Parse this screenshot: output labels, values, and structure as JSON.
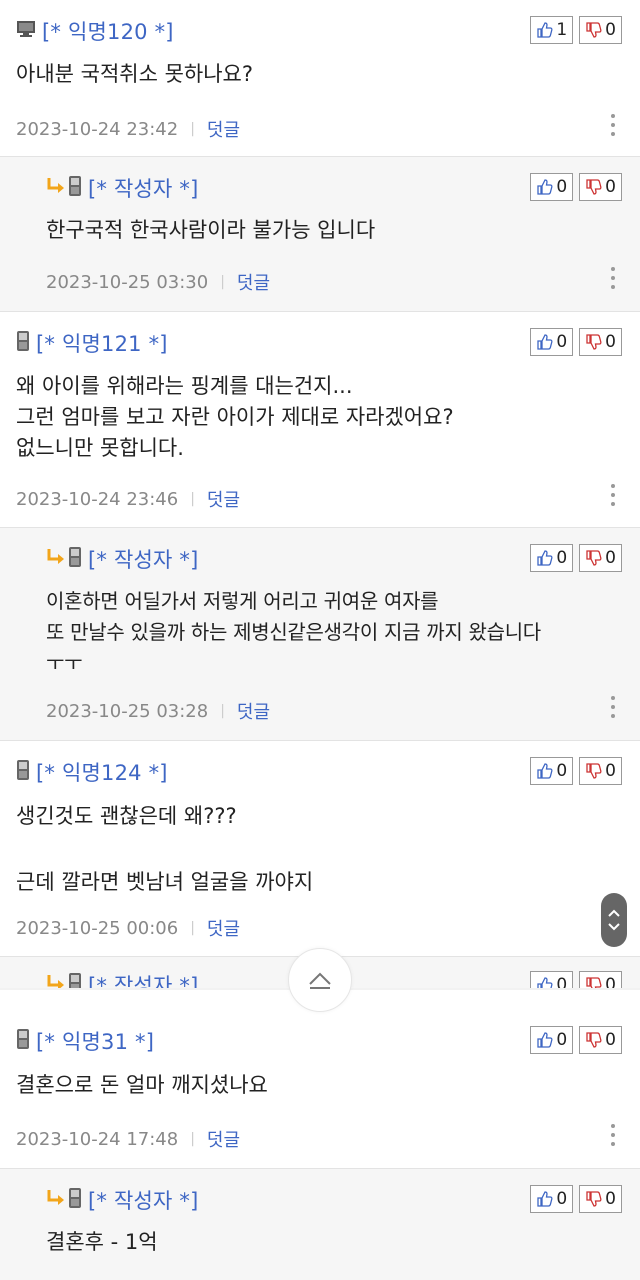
{
  "comments": [
    {
      "type": "comment",
      "device": "pc",
      "author": "[* 익명120 *]",
      "text": "아내분 국적취소 못하나요?",
      "date": "2023-10-24 23:42",
      "reply": "덧글",
      "up": "1",
      "down": "0"
    },
    {
      "type": "reply",
      "device": "mobile",
      "author": "[* 작성자 *]",
      "text": "한구국적 한국사람이라 불가능 입니다",
      "date": "2023-10-25 03:30",
      "reply": "덧글",
      "up": "0",
      "down": "0"
    },
    {
      "type": "comment",
      "device": "mobile",
      "author": "[* 익명121 *]",
      "text": "왜 아이를 위해라는 핑계를 대는건지...\n그런 엄마를 보고 자란 아이가 제대로 자라겠어요?\n없느니만 못합니다.",
      "date": "2023-10-24 23:46",
      "reply": "덧글",
      "up": "0",
      "down": "0"
    },
    {
      "type": "reply",
      "device": "mobile",
      "author": "[* 작성자 *]",
      "text": "이혼하면 어딜가서 저렇게 어리고 귀여운 여자를\n또 만날수 있을까 하는 제병신같은생각이 지금 까지 왔습니다\nㅜㅜ",
      "date": "2023-10-25 03:28",
      "reply": "덧글",
      "up": "0",
      "down": "0"
    },
    {
      "type": "comment",
      "device": "mobile",
      "author": "[* 익명124 *]",
      "text": "생긴것도 괜찮은데 왜???\n\n근데 깔라면 벳남녀 얼굴을 까야지",
      "date": "2023-10-25 00:06",
      "reply": "덧글",
      "up": "0",
      "down": "0"
    },
    {
      "type": "reply",
      "device": "mobile",
      "author": "[* 작성자 *]",
      "text": "",
      "date": "",
      "reply": "",
      "up": "0",
      "down": "0"
    },
    {
      "type": "comment",
      "device": "mobile",
      "author": "[* 익명31 *]",
      "text": "결혼으로 돈 얼마 깨지셨나요",
      "date": "2023-10-24 17:48",
      "reply": "덧글",
      "up": "0",
      "down": "0"
    },
    {
      "type": "reply",
      "device": "mobile",
      "author": "[* 작성자 *]",
      "text": "결혼후 - 1억",
      "date": "",
      "reply": "",
      "up": "0",
      "down": "0"
    }
  ],
  "colors": {
    "author": "#3e66c4",
    "meta": "#888888",
    "reply_bg": "#f6f6f6"
  },
  "icons": {
    "pc": "monitor-icon",
    "mobile": "phone-icon",
    "reply_arrow": "reply-arrow-icon",
    "up": "thumbs-up-icon",
    "down": "thumbs-down-icon",
    "more": "more-vertical-icon",
    "scroll": "scroll-handle-icon",
    "top": "scroll-to-top-icon"
  }
}
